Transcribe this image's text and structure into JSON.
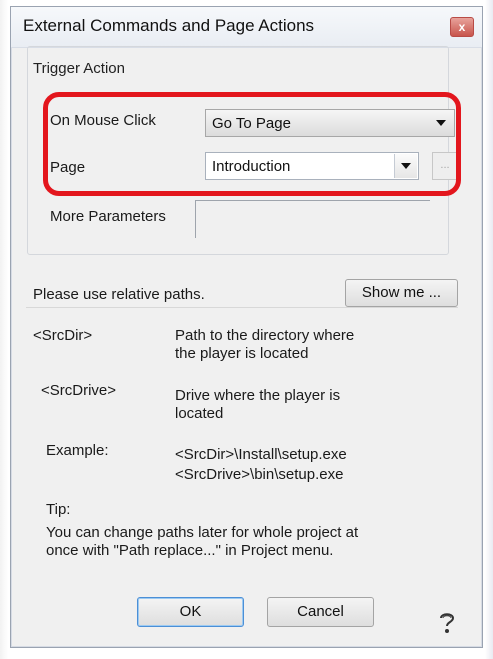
{
  "dialog": {
    "title": "External Commands and Page Actions",
    "close_glyph": "x"
  },
  "trigger": {
    "group_title": "Trigger Action",
    "on_mouse_click_label": "On Mouse Click",
    "on_mouse_click_value": "Go To Page",
    "page_label": "Page",
    "page_value": "Introduction",
    "ellipsis_label": "...",
    "more_parameters_label": "More Parameters"
  },
  "hint": {
    "text": "Please use relative paths.",
    "show_me_label": "Show me ..."
  },
  "info": {
    "srcdir_key": "<SrcDir>",
    "srcdir_desc_1": "Path to the directory where",
    "srcdir_desc_2": "the player is located",
    "srcdrive_key": "<SrcDrive>",
    "srcdrive_desc_1": "Drive where the player is",
    "srcdrive_desc_2": "located",
    "example_label": "Example:",
    "example_1": "<SrcDir>\\Install\\setup.exe",
    "example_2": "<SrcDrive>\\bin\\setup.exe",
    "tip_label": "Tip:",
    "tip_line_1": "You can change paths later for whole project  at",
    "tip_line_2": "once with \"Path replace...\" in Project menu."
  },
  "buttons": {
    "ok": "OK",
    "cancel": "Cancel"
  },
  "icons": {
    "help": "help-question-icon",
    "close": "close-icon",
    "dropdown": "chevron-down-icon"
  },
  "colors": {
    "highlight": "#e3161d",
    "close_button": "#c8554c"
  }
}
